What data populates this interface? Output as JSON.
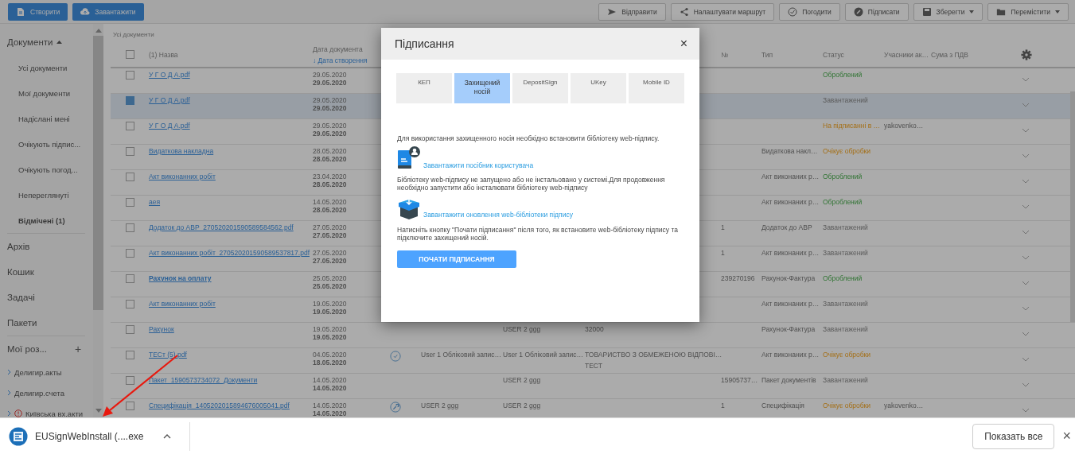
{
  "toolbar": {
    "left_buttons": [
      {
        "label": "Створити",
        "kind": "document"
      },
      {
        "label": "Завантажити",
        "kind": "cloud"
      }
    ],
    "right_buttons": [
      {
        "label": "Відправити",
        "kind": "send",
        "dropdown": false
      },
      {
        "label": "Налаштувати маршрут",
        "kind": "share",
        "dropdown": false
      },
      {
        "label": "Погодити",
        "kind": "check",
        "dropdown": false
      },
      {
        "label": "Підписати",
        "kind": "pen",
        "dropdown": false
      },
      {
        "label": "Зберегти",
        "kind": "save",
        "dropdown": true
      },
      {
        "label": "Перемістити",
        "kind": "folder",
        "dropdown": true
      }
    ]
  },
  "sidebar": {
    "sections": [
      {
        "label": "Документи",
        "expanded": true,
        "children": [
          {
            "label": "Усі документи",
            "bold": false
          },
          {
            "label": "Мої документи",
            "bold": false
          },
          {
            "label": "Надіслані мені",
            "bold": false
          },
          {
            "label": "Очікують підпис...",
            "bold": false
          },
          {
            "label": "Очікують погод...",
            "bold": false
          },
          {
            "label": "Непереглянуті",
            "bold": false
          },
          {
            "label": "Відмічені (1)",
            "bold": true
          }
        ]
      },
      {
        "label": "Архів"
      },
      {
        "label": "Кошик"
      },
      {
        "label": "Задачі"
      },
      {
        "label": "Пакети"
      }
    ],
    "my_folders": {
      "label": "Мої роз...",
      "add": "+",
      "folders": [
        {
          "label": "Делигир.акты",
          "warning": false
        },
        {
          "label": "Делигир.счета",
          "warning": false
        },
        {
          "label": "Київська вх.акти",
          "warning": true
        }
      ]
    }
  },
  "table": {
    "breadcrumb": "Усі документи",
    "header_checked": false,
    "columns": {
      "name": "(1) Назва",
      "date": "Дата документа",
      "date_sort": "↓ Дата створення",
      "number": "№",
      "type": "Тип",
      "status": "Статус",
      "participants": "Учасники ак…",
      "sum": "Сума з ПДВ"
    },
    "rows": [
      {
        "name": "У Г О Д А.pdf",
        "bold": false,
        "checked": false,
        "selected": false,
        "date": "29.05.2020",
        "created": "29.05.2020",
        "status": {
          "text": "Оброблений",
          "kind": "processed"
        }
      },
      {
        "name": "У Г О Д А.pdf",
        "bold": false,
        "checked": true,
        "selected": true,
        "date": "29.05.2020",
        "created": "29.05.2020",
        "status": {
          "text": "Завантажений",
          "kind": "loaded"
        }
      },
      {
        "name": "У Г О Д А.pdf",
        "bold": false,
        "checked": false,
        "selected": false,
        "date": "29.05.2020",
        "created": "29.05.2020",
        "status": {
          "text": "На підписанні в …",
          "kind": "pending"
        },
        "participants": "yakovenko…"
      },
      {
        "name": "Видаткова накладна",
        "bold": false,
        "checked": false,
        "selected": false,
        "date": "28.05.2020",
        "created": "28.05.2020",
        "type": "Видаткова накл…",
        "status": {
          "text": "Очікує обробки",
          "kind": "pending"
        }
      },
      {
        "name": "Акт виконанних робіт",
        "bold": false,
        "checked": false,
        "selected": false,
        "date": "23.04.2020",
        "created": "28.05.2020",
        "type": "Акт виконаних р…",
        "status": {
          "text": "Оброблений",
          "kind": "processed"
        }
      },
      {
        "name": "аея",
        "bold": false,
        "checked": false,
        "selected": false,
        "date": "14.05.2020",
        "created": "28.05.2020",
        "type": "Акт виконаних р…",
        "status": {
          "text": "Оброблений",
          "kind": "processed"
        }
      },
      {
        "name": "Додаток до АВР_270520201590589584562.pdf",
        "bold": false,
        "checked": false,
        "selected": false,
        "date": "27.05.2020",
        "created": "27.05.2020",
        "number": "1",
        "type": "Додаток до АВР",
        "status": {
          "text": "Завантажений",
          "kind": "loaded"
        }
      },
      {
        "name": "Акт виконанних робіт_270520201590589537817.pdf",
        "bold": false,
        "checked": false,
        "selected": false,
        "date": "27.05.2020",
        "created": "27.05.2020",
        "number": "1",
        "type": "Акт виконаних р…",
        "status": {
          "text": "Завантажений",
          "kind": "loaded"
        }
      },
      {
        "name": "Рахунок на оплату",
        "bold": true,
        "checked": false,
        "selected": false,
        "date": "25.05.2020",
        "created": "25.05.2020",
        "number": "239270196",
        "type": "Рахунок-Фактура",
        "status": {
          "text": "Оброблений",
          "kind": "processed"
        }
      },
      {
        "name": "Акт виконанних робіт",
        "bold": false,
        "checked": false,
        "selected": false,
        "date": "19.05.2020",
        "created": "19.05.2020",
        "type": "Акт виконаних р…",
        "status": {
          "text": "Завантажений",
          "kind": "loaded"
        }
      },
      {
        "name": "Рахунок",
        "bold": false,
        "checked": false,
        "selected": false,
        "date": "19.05.2020",
        "created": "19.05.2020",
        "receiver": "USER 2 ggg",
        "counterparty": "32000",
        "type": "Рахунок-Фактура",
        "status": {
          "text": "Завантажений",
          "kind": "loaded"
        }
      },
      {
        "name": "ТЕСт (5).pdf",
        "bold": false,
        "checked": false,
        "selected": false,
        "date": "04.05.2020",
        "created": "18.05.2020",
        "kind": "check",
        "sender": "User 1 Обліковий запис…",
        "receiver": "User 1 Обліковий запис…",
        "counterparty": "ТОВАРИСТВО З ОБМЕЖЕНОЮ ВІДПОВІ…",
        "counterparty_2": "ТЕСТ",
        "type": "Акт виконаних р…",
        "status": {
          "text": "Очікує обробки",
          "kind": "pending"
        }
      },
      {
        "name": "Пакет_1590573734072_Документи",
        "bold": false,
        "checked": false,
        "selected": false,
        "date": "14.05.2020",
        "created": "14.05.2020",
        "receiver": "USER 2 ggg",
        "number": "15905737…",
        "type": "Пакет документів",
        "status": {
          "text": "Завантажений",
          "kind": "loaded"
        }
      },
      {
        "name": "Специфікація_1405202015894676005041.pdf",
        "bold": false,
        "checked": false,
        "selected": false,
        "date": "14.05.2020",
        "created": "14.05.2020",
        "kind": "wrench",
        "sender": "USER 2 ggg",
        "receiver": "USER 2 ggg",
        "number": "1",
        "type": "Специфікація",
        "status": {
          "text": "Очікує обробки",
          "kind": "pending"
        },
        "participants": "yakovenko…"
      }
    ]
  },
  "modal": {
    "title": "Підписання",
    "close": "×",
    "tabs": [
      {
        "label": "КЕП",
        "selected": false
      },
      {
        "label": "Захищений носій",
        "selected": true
      },
      {
        "label": "DepositSign",
        "selected": false
      },
      {
        "label": "UKey",
        "selected": false
      },
      {
        "label": "Mobile ID",
        "selected": false
      }
    ],
    "intro": "Для використання захищенного носія необхідно встановити бібліотеку web-підпису.",
    "guide_link": "Завантажити посібник користувача",
    "library_note": "Бібліотеку web-підпису не запущено або не інстальовано у системі.Для продовження необхідно запустити або інсталювати бібліотеку web-підпису",
    "update_link": "Завантажити оновлення web-бібліотеки підпису",
    "instruction": "Натисніть кнопку \"Почати підписання\" після того, як встановите web-бібліотеку підпису та підключите захищений носій.",
    "button": "ПОЧАТИ ПІДПИСАННЯ"
  },
  "download_bar": {
    "file": "EUSignWebInstall (....exe",
    "show_all": "Показать все",
    "close": "×"
  }
}
